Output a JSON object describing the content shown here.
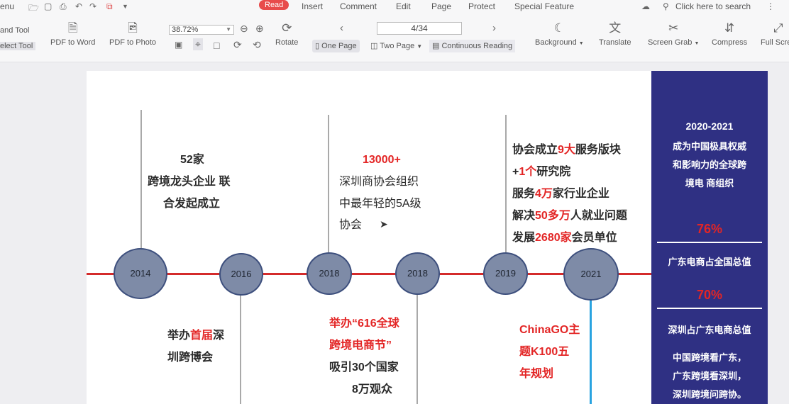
{
  "menu": {
    "menu_label": "enu",
    "read": "Read",
    "insert": "Insert",
    "comment": "Comment",
    "edit": "Edit",
    "page": "Page",
    "protect": "Protect",
    "special": "Special Feature",
    "search": "Click here to search"
  },
  "toolbar": {
    "hand_tool": "and Tool",
    "select_tool": "elect Tool",
    "pdf_to_word": "PDF to Word",
    "pdf_to_photo": "PDF to Photo",
    "zoom": "38.72%",
    "rotate": "Rotate",
    "page_indicator": "4/34",
    "one_page": "One Page",
    "two_page": "Two Page",
    "continuous": "Continuous Reading",
    "background": "Background",
    "translate": "Translate",
    "screen_grab": "Screen Grab",
    "compress": "Compress",
    "full_screen": "Full Scre"
  },
  "timeline": {
    "nodes": [
      "2014",
      "2016",
      "2018",
      "2018",
      "2019",
      "2021"
    ],
    "t2014": {
      "l1": "52家",
      "l2": "跨境龙头企业 联",
      "l3": "合发起成立"
    },
    "t2016": {
      "l1a": "举办",
      "l1b": "首届",
      "l1c": "深",
      "l2": "圳跨博会"
    },
    "t2018a": {
      "l1": "13000+",
      "l2": "深圳商协会组织",
      "l3": "中最年轻的5A级",
      "l4": "协会"
    },
    "t2018b": {
      "l1": "举办“616全球",
      "l2": "跨境电商节”",
      "l3": "吸引30个国家",
      "l4": "8万观众"
    },
    "t2019": {
      "r1a": "协会成立",
      "r1b": "9大",
      "r1c": "服务版块",
      "r2a": "+",
      "r2b": "1个",
      "r2c": "研究院",
      "r3a": "服务",
      "r3b": "4万",
      "r3c": "家行业企业",
      "r4a": "解决",
      "r4b": "50多万",
      "r4c": "人就业问题",
      "r5a": "发展",
      "r5b": "2680家",
      "r5c": "会员单位"
    },
    "t2021": {
      "l1": "ChinaGO主",
      "l2": "题K100五",
      "l3": "年规划"
    }
  },
  "sidepanel": {
    "years": "2020-2021",
    "desc1": "成为中国极具权威",
    "desc2": "和影响力的全球跨",
    "desc3": "境电 商组织",
    "pct1": "76%",
    "label1": "广东电商占全国总值",
    "pct2": "70%",
    "label2": "深圳占广东电商总值",
    "footer1": "中国跨境看广东，",
    "footer2": "广东跨境看深圳，",
    "footer3": "深圳跨境问跨协。"
  }
}
